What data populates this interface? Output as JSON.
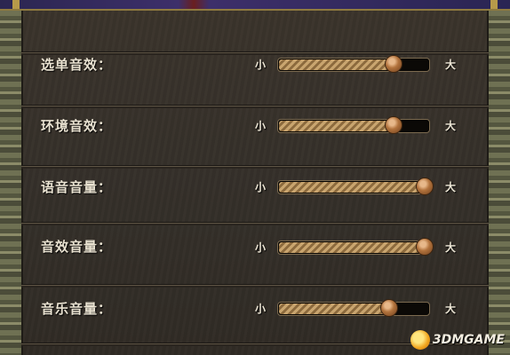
{
  "top_bar": {
    "palette": [
      "#2b2650",
      "#6a1f20"
    ]
  },
  "scale": {
    "min_label": "小",
    "max_label": "大"
  },
  "settings": [
    {
      "label": "选单音效：",
      "level": 0.76
    },
    {
      "label": "环境音效：",
      "level": 0.76
    },
    {
      "label": "语音音量：",
      "level": 0.97
    },
    {
      "label": "音效音量：",
      "level": 0.97
    },
    {
      "label": "音乐音量：",
      "level": 0.73
    }
  ],
  "watermark": {
    "text": "3DMGAME",
    "icon": "3dm-logo-icon"
  }
}
